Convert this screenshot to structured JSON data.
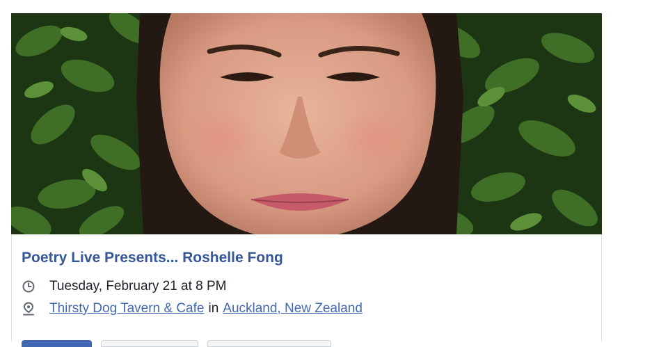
{
  "event": {
    "title": "Poetry Live Presents... Roshelle Fong",
    "datetime": "Tuesday, February 21 at 8 PM",
    "venue": "Thirsty Dog Tavern & Cafe",
    "location_connector": "in",
    "location": "Auckland, New Zealand"
  },
  "icons": {
    "time": "clock-icon",
    "place": "map-pin-icon"
  },
  "colors": {
    "title": "#365899",
    "link": "#4267b2",
    "text": "#1d2129",
    "icon": "#606770"
  }
}
